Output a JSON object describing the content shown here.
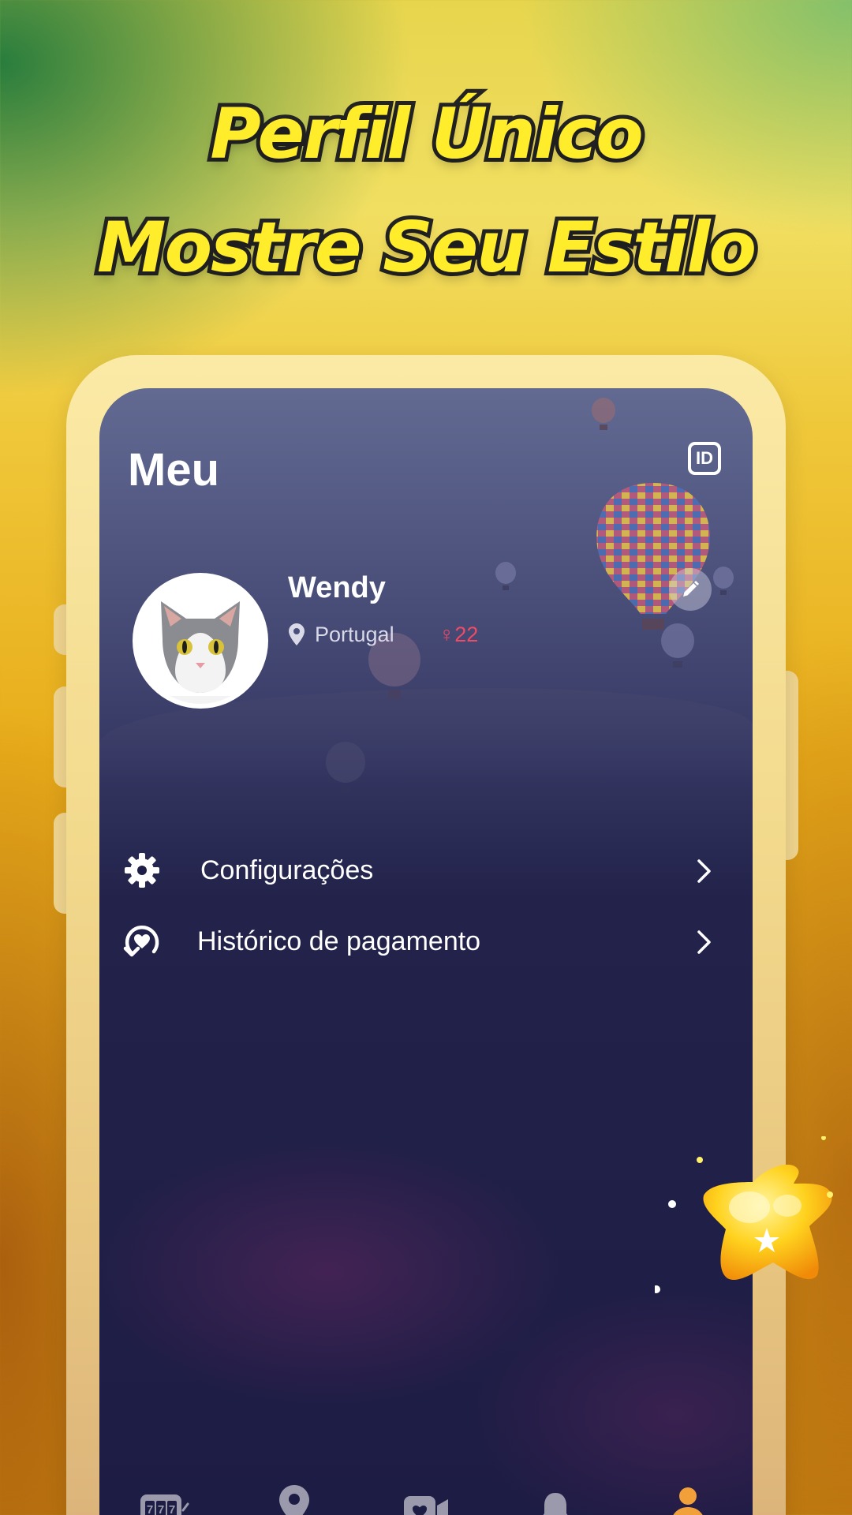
{
  "headline": {
    "line1": "Perfil Único",
    "line2": "Mostre Seu Estilo"
  },
  "colors": {
    "headline_fill": "#ffec2a",
    "headline_stroke": "#242424",
    "screen_bg": "#1d1c44",
    "gender_accent": "#f04a66",
    "active_tab": "#f2a03a",
    "inactive_tab": "#9a9aac"
  },
  "header": {
    "title": "Meu",
    "id_icon": "ID"
  },
  "profile": {
    "name": "Wendy",
    "location": "Portugal",
    "gender_symbol": "♀",
    "age": "22",
    "avatar_icon": "cat-photo",
    "edit_icon": "pencil-icon"
  },
  "menu": [
    {
      "label": "Configurações",
      "icon": "gear-icon"
    },
    {
      "label": "Histórico de pagamento",
      "icon": "payment-history-icon"
    }
  ],
  "tabs": [
    {
      "name": "slots",
      "icon": "slot-machine-icon",
      "text": "777",
      "active": false
    },
    {
      "name": "nearby",
      "icon": "location-pin-icon",
      "active": false
    },
    {
      "name": "video",
      "icon": "video-heart-icon",
      "active": false
    },
    {
      "name": "notifications",
      "icon": "bell-icon",
      "active": false
    },
    {
      "name": "profile",
      "icon": "person-icon",
      "active": true
    }
  ]
}
